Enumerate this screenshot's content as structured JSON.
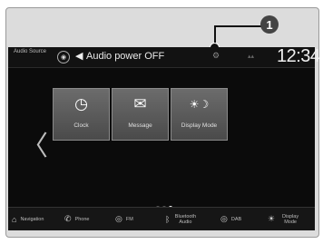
{
  "callout": {
    "number": "1"
  },
  "status": {
    "source_label": "Audio Source",
    "source_icon": "audio-source-icon",
    "speaker_icon": "speaker-off-icon",
    "audio_text": "Audio power OFF",
    "indicator_icon": "settings-indicator-icon",
    "time": "12:34"
  },
  "home": {
    "tiles": [
      {
        "label": "Clock",
        "icon": "clock-icon"
      },
      {
        "label": "Message",
        "icon": "envelope-icon"
      },
      {
        "label": "Display Mode",
        "icon": "display-mode-icon"
      }
    ],
    "page_indicator": {
      "pages": 3,
      "active": 3
    }
  },
  "navbar": {
    "items": [
      {
        "label": "Navigation",
        "icon": "navigation-icon"
      },
      {
        "label": "Phone",
        "icon": "phone-icon"
      },
      {
        "label": "FM",
        "icon": "fm-icon"
      },
      {
        "label": "Bluetooth Audio",
        "icon": "bluetooth-icon"
      },
      {
        "label": "DAB",
        "icon": "dab-icon"
      },
      {
        "label": "Display Mode",
        "icon": "display-mode-icon"
      }
    ]
  }
}
